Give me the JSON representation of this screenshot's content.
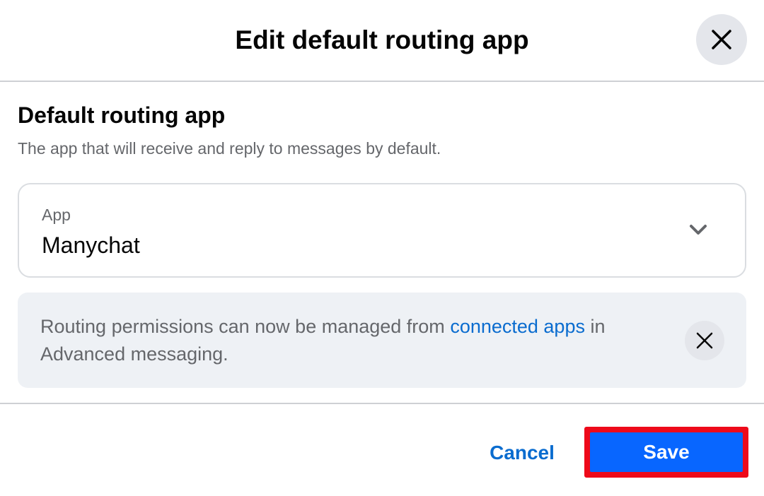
{
  "dialog": {
    "title": "Edit default routing app",
    "close_icon": "close-icon"
  },
  "section": {
    "heading": "Default routing app",
    "description": "The app that will receive and reply to messages by default."
  },
  "app_select": {
    "label": "App",
    "value": "Manychat",
    "icon": "chevron-down-icon"
  },
  "notice": {
    "text_before": "Routing permissions can now be managed from ",
    "link_text": "connected apps",
    "text_after": " in Advanced messaging.",
    "close_icon": "close-icon"
  },
  "footer": {
    "cancel_label": "Cancel",
    "save_label": "Save"
  },
  "colors": {
    "primary": "#0866ff",
    "link": "#0a6ccf",
    "highlight": "#ee0a1a",
    "notice_bg": "#eef1f5"
  }
}
